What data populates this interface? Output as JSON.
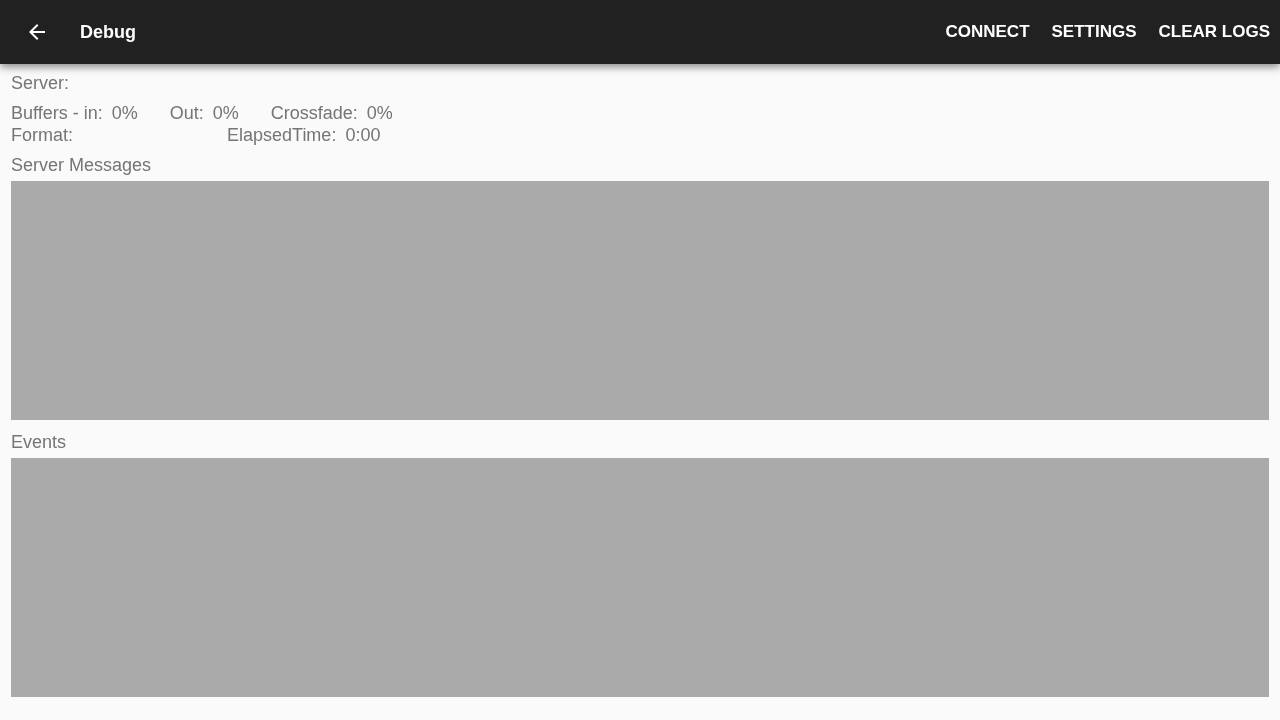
{
  "toolbar": {
    "title": "Debug",
    "actions": [
      "CONNECT",
      "SETTINGS",
      "CLEAR LOGS"
    ]
  },
  "server": {
    "label": "Server:"
  },
  "buffers": [
    {
      "label": "Buffers - in:",
      "value": "0%"
    },
    {
      "label": "Out:",
      "value": "0%"
    },
    {
      "label": "Crossfade:",
      "value": "0%"
    }
  ],
  "format": {
    "label": "Format:"
  },
  "elapsed": {
    "label": "ElapsedTime:",
    "value": "0:00"
  },
  "panels": [
    {
      "title": "Server Messages"
    },
    {
      "title": "Events"
    }
  ]
}
